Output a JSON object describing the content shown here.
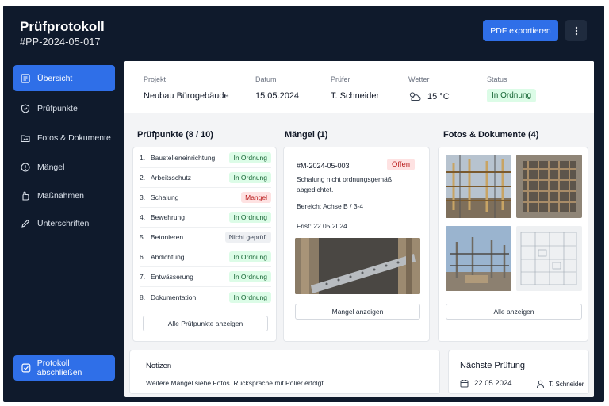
{
  "header": {
    "title": "Prüfprotokoll",
    "subtitle": "#PP-2024-05-017",
    "export_label": "PDF exportieren",
    "more_icon": "more-vertical-icon"
  },
  "sidebar": {
    "items": [
      {
        "label": "Übersicht",
        "icon": "overview-icon",
        "active": true
      },
      {
        "label": "Prüfpunkte",
        "icon": "checkpoint-icon"
      },
      {
        "label": "Fotos & Dokumente",
        "icon": "folder-image-icon"
      },
      {
        "label": "Mängel",
        "icon": "warning-icon"
      },
      {
        "label": "Maßnahmen",
        "icon": "hand-icon"
      },
      {
        "label": "Unterschriften",
        "icon": "pen-icon"
      }
    ],
    "close_label": "Protokoll abschließen"
  },
  "info": {
    "project_label": "Projekt",
    "project_value": "Neubau Bürogebäude",
    "date_label": "Datum",
    "date_value": "15.05.2024",
    "inspector_label": "Prüfer",
    "inspector_value": "T. Schneider",
    "weather_label": "Wetter",
    "weather_value": "15 °C",
    "weather_icon": "partly-cloudy-icon",
    "status_label": "Status",
    "status_value": "In Ordnung"
  },
  "checklist": {
    "title": "Prüfpunkte (8 / 10)",
    "items": [
      {
        "num": "1.",
        "name": "Baustelleneinrichtung",
        "status": "In Ordnung",
        "color": "green"
      },
      {
        "num": "2.",
        "name": "Arbeitsschutz",
        "status": "In Ordnung",
        "color": "green"
      },
      {
        "num": "3.",
        "name": "Schalung",
        "status": "Mangel",
        "color": "red"
      },
      {
        "num": "4.",
        "name": "Bewehrung",
        "status": "In Ordnung",
        "color": "green"
      },
      {
        "num": "5.",
        "name": "Betonieren",
        "status": "Nicht geprüft",
        "color": "gray"
      },
      {
        "num": "6.",
        "name": "Abdichtung",
        "status": "In Ordnung",
        "color": "green"
      },
      {
        "num": "7.",
        "name": "Entwässerung",
        "status": "In Ordnung",
        "color": "green"
      },
      {
        "num": "8.",
        "name": "Dokumentation",
        "status": "In Ordnung",
        "color": "green"
      }
    ],
    "show_all_label": "Alle Prüfpunkte anzeigen"
  },
  "defects": {
    "title": "Mängel (1)",
    "id": "#M-2024-05-003",
    "status": "Offen",
    "description": "Schalung nicht ordnungsgemäß abgedichtet.",
    "area": "Bereich: Achse B / 3-4",
    "due": "Frist: 22.05.2024",
    "show_label": "Mangel anzeigen"
  },
  "photos": {
    "title": "Fotos & Dokumente (4)",
    "show_all_label": "Alle anzeigen"
  },
  "notes": {
    "title": "Notizen",
    "text": "Weitere Mängel siehe Fotos. Rücksprache mit Polier erfolgt."
  },
  "next_inspection": {
    "title": "Nächste Prüfung",
    "date": "22.05.2024",
    "person": "T. Schneider",
    "calendar_icon": "calendar-icon",
    "person_icon": "user-icon"
  },
  "colors": {
    "accent": "#2f6fe8",
    "sidebar_bg": "#0f1a2c",
    "ok_bg": "#dcfce7",
    "ok_text": "#166534",
    "defect_bg": "#fee2e2",
    "defect_text": "#b91c1c"
  }
}
